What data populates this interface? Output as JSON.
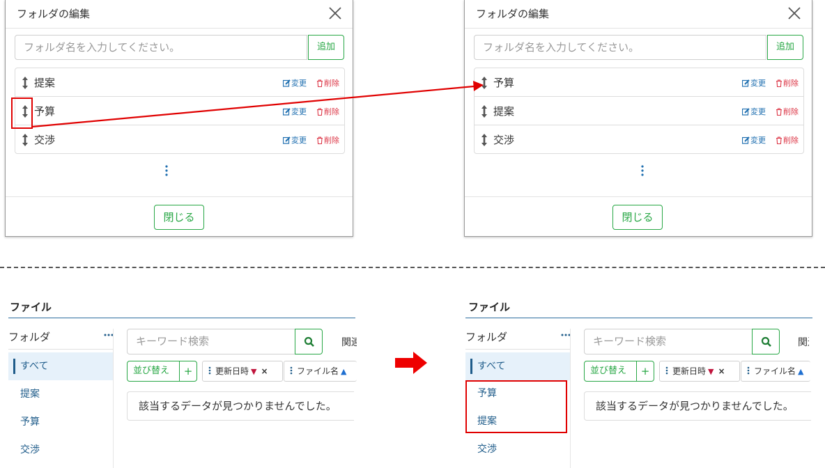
{
  "dialog": {
    "title": "フォルダの編集",
    "input_placeholder": "フォルダ名を入力してください。",
    "add_label": "追加",
    "edit_label": "変更",
    "delete_label": "削除",
    "close_label": "閉じる",
    "before_items": [
      "提案",
      "予算",
      "交渉"
    ],
    "after_items": [
      "予算",
      "提案",
      "交渉"
    ]
  },
  "file_panel": {
    "title": "ファイル",
    "folder_label": "フォルダ",
    "search_placeholder": "キーワード検索",
    "related_cut": "関連",
    "sort_label": "並び替え",
    "plus_label": "+",
    "sort_chip_1": "更新日時",
    "sort_chip_2": "ファイル名",
    "empty_message": "該当するデータが見つかりませんでした。",
    "before_folders": [
      "すべて",
      "提案",
      "予算",
      "交渉"
    ],
    "after_folders": [
      "すべて",
      "予算",
      "提案",
      "交渉"
    ]
  },
  "colors": {
    "accent_green": "#28a745",
    "annotation_red": "#e00000",
    "link_blue": "#1f6fb0",
    "danger_red": "#dc3545",
    "header_line": "#2b6c9e"
  },
  "icons": {
    "close": "close-icon",
    "drag_handle": "drag-handle-icon",
    "edit": "edit-icon",
    "trash": "trash-icon",
    "vertical_dots": "more-vertical-icon",
    "horizontal_dots": "more-horizontal-icon",
    "search": "search-icon",
    "arrow_right": "arrow-right-icon"
  }
}
